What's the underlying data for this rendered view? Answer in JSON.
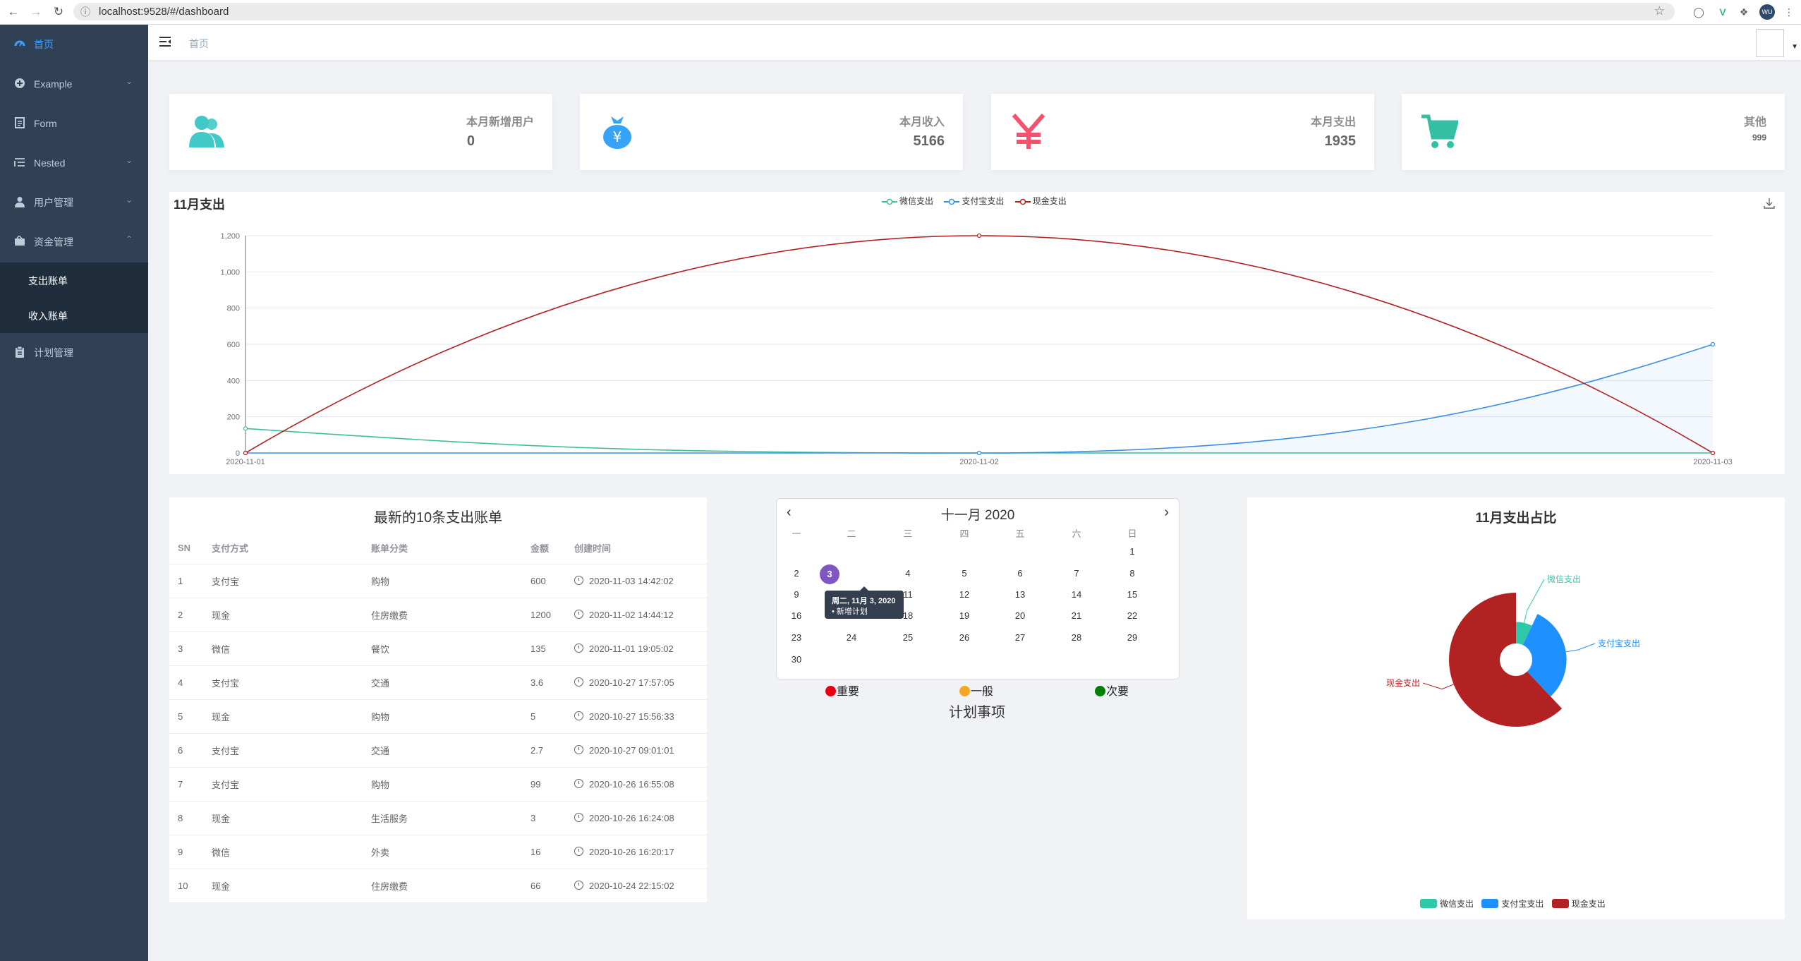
{
  "browser": {
    "url": "localhost:9528/#/dashboard",
    "profile_initials": "WU"
  },
  "sidebar": {
    "items": [
      {
        "label": "首页",
        "icon": "dashboard-icon"
      },
      {
        "label": "Example",
        "icon": "plus-circle-icon"
      },
      {
        "label": "Form",
        "icon": "form-icon"
      },
      {
        "label": "Nested",
        "icon": "nested-icon"
      },
      {
        "label": "用户管理",
        "icon": "user-icon"
      },
      {
        "label": "资金管理",
        "icon": "wallet-icon"
      },
      {
        "label": "计划管理",
        "icon": "clipboard-icon"
      }
    ],
    "subitems": [
      {
        "label": "支出账单"
      },
      {
        "label": "收入账单"
      }
    ]
  },
  "navbar": {
    "breadcrumb": "首页"
  },
  "cards": [
    {
      "title": "本月新增用户",
      "value": "0",
      "icon": "users-icon",
      "color": "#40c9c6"
    },
    {
      "title": "本月收入",
      "value": "5166",
      "icon": "money-bag-icon",
      "color": "#36a3f7"
    },
    {
      "title": "本月支出",
      "value": "1935",
      "icon": "yen-icon",
      "color": "#f4516c"
    },
    {
      "title": "其他",
      "value": "999",
      "icon": "shopping-cart-icon",
      "color": "#34bfa3"
    }
  ],
  "line_chart_title": "11月支出",
  "bill_table": {
    "title": "最新的10条支出账单",
    "columns": [
      "SN",
      "支付方式",
      "账单分类",
      "金额",
      "创建时间"
    ],
    "rows": [
      [
        "1",
        "支付宝",
        "购物",
        "600",
        "2020-11-03 14:42:02"
      ],
      [
        "2",
        "现金",
        "住房缴费",
        "1200",
        "2020-11-02 14:44:12"
      ],
      [
        "3",
        "微信",
        "餐饮",
        "135",
        "2020-11-01 19:05:02"
      ],
      [
        "4",
        "支付宝",
        "交通",
        "3.6",
        "2020-10-27 17:57:05"
      ],
      [
        "5",
        "现金",
        "购物",
        "5",
        "2020-10-27 15:56:33"
      ],
      [
        "6",
        "支付宝",
        "交通",
        "2.7",
        "2020-10-27 09:01:01"
      ],
      [
        "7",
        "支付宝",
        "购物",
        "99",
        "2020-10-26 16:55:08"
      ],
      [
        "8",
        "现金",
        "生活服务",
        "3",
        "2020-10-26 16:24:08"
      ],
      [
        "9",
        "微信",
        "外卖",
        "16",
        "2020-10-26 16:20:17"
      ],
      [
        "10",
        "现金",
        "住房缴费",
        "66",
        "2020-10-24 22:15:02"
      ]
    ]
  },
  "calendar": {
    "title": "十一月 2020",
    "weekdays": [
      "一",
      "二",
      "三",
      "四",
      "五",
      "六",
      "日"
    ],
    "selected_day": "3",
    "tooltip_date": "周二, 11月 3, 2020",
    "tooltip_event": "• 新增计划",
    "legend": [
      {
        "label": "重要",
        "color": "#e60012"
      },
      {
        "label": "一般",
        "color": "#f5a623"
      },
      {
        "label": "次要",
        "color": "#008000"
      }
    ],
    "plan_title": "计划事项"
  },
  "pie_title": "11月支出占比",
  "chart_data": [
    {
      "type": "line",
      "title": "11月支出",
      "x": [
        "2020-11-01",
        "2020-11-02",
        "2020-11-03"
      ],
      "ylim": [
        0,
        1200
      ],
      "yticks": [
        "0",
        "200",
        "400",
        "600",
        "800",
        "1,000",
        "1,200"
      ],
      "legend_position": "top-center",
      "series": [
        {
          "name": "微信支出",
          "values": [
            135,
            0,
            0
          ],
          "color": "#3bbf9b"
        },
        {
          "name": "支付宝支出",
          "values": [
            0,
            0,
            600
          ],
          "color": "#3a8ee6",
          "area": true
        },
        {
          "name": "现金支出",
          "values": [
            0,
            1200,
            0
          ],
          "color": "#b22222"
        }
      ],
      "smooth": true,
      "grid": true
    },
    {
      "type": "pie",
      "title": "11月支出占比",
      "rose": true,
      "legend_position": "bottom-center",
      "slices": [
        {
          "name": "微信支出",
          "value": 135,
          "color": "#2ec7a9"
        },
        {
          "name": "支付宝支出",
          "value": 600,
          "color": "#1e90ff"
        },
        {
          "name": "现金支出",
          "value": 1200,
          "color": "#b22222"
        }
      ]
    }
  ]
}
